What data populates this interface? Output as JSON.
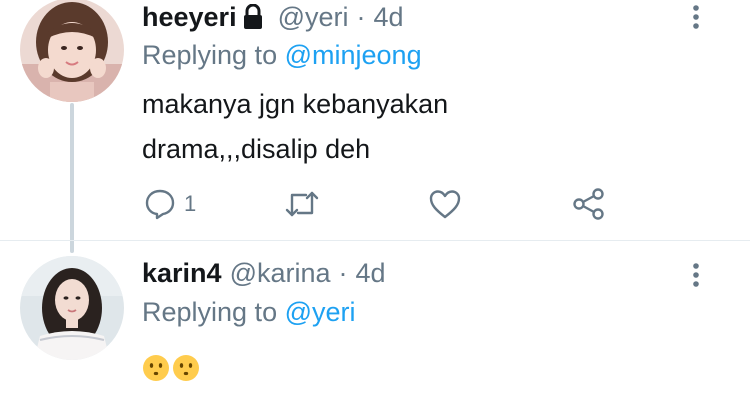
{
  "tweets": [
    {
      "display_name": "heeyeri",
      "handle": "@yeri",
      "separator": "·",
      "time": "4d",
      "replying_prefix": "Replying to",
      "replying_to": "@minjeong",
      "text": "makanya jgn kebanyakan\ndrama,,,disalip deh",
      "protected": true,
      "reply_count": "1"
    },
    {
      "display_name": "karin4",
      "handle": "@karina",
      "separator": "·",
      "time": "4d",
      "replying_prefix": "Replying to",
      "replying_to": "@yeri",
      "emojis": [
        "hushed-face-emoji",
        "hushed-face-emoji"
      ]
    }
  ],
  "icons": {
    "reply": "comment-bubble-icon",
    "retweet": "retweet-icon",
    "like": "heart-icon",
    "share": "share-icon",
    "more": "vertical-dots-icon",
    "lock": "lock-icon"
  },
  "colors": {
    "text_primary": "#14171a",
    "text_secondary": "#657786",
    "link": "#1da1f2",
    "thread_line": "#ccd6dd",
    "emoji_yellow": "#ffcc4d"
  }
}
